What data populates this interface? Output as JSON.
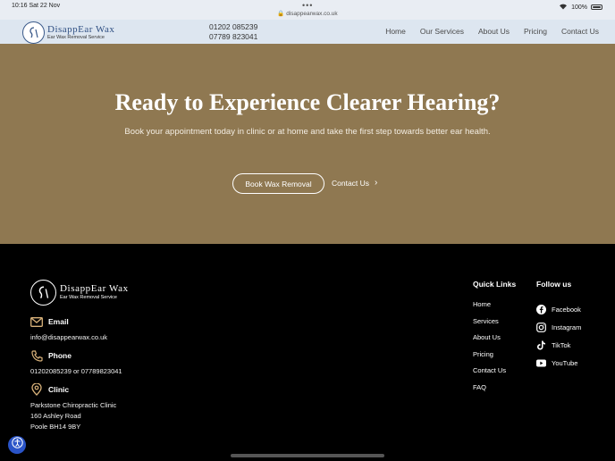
{
  "status": {
    "time": "10:16",
    "date": "Sat 22 Nov",
    "url": "disappearwax.co.uk",
    "battery": "100%"
  },
  "header": {
    "logo_name": "DisappEar Wax",
    "logo_sub": "Ear Wax Removal Service",
    "phone1": "01202 085239",
    "phone2": "07789 823041",
    "nav": [
      "Home",
      "Our Services",
      "About Us",
      "Pricing",
      "Contact Us"
    ]
  },
  "hero": {
    "title": "Ready to Experience Clearer Hearing?",
    "subtitle": "Book your appointment today in clinic or at home and take the first step towards better ear health.",
    "book_label": "Book Wax Removal",
    "contact_label": "Contact Us"
  },
  "footer": {
    "logo_name": "DisappEar Wax",
    "logo_sub": "Ear Wax Removal Service",
    "email_label": "Email",
    "email_value": "info@disappearwax.co.uk",
    "phone_label": "Phone",
    "phone_value": "01202085239 or 07789823041",
    "clinic_label": "Clinic",
    "clinic_lines": [
      "Parkstone Chiropractic Clinic",
      "160 Ashley Road",
      "Poole BH14 9BY"
    ],
    "quick_links_title": "Quick Links",
    "quick_links": [
      "Home",
      "Services",
      "About Us",
      "Pricing",
      "Contact Us",
      "FAQ"
    ],
    "follow_title": "Follow us",
    "follow": [
      "Facebook",
      "Instagram",
      "TikTok",
      "YouTube"
    ]
  },
  "colors": {
    "hero_bg": "#8f7851",
    "header_bg": "#dde6f0",
    "footer_bg": "#000000",
    "accent_icon": "#d9b27a"
  },
  "icons": {
    "email": "envelope-icon",
    "phone": "phone-icon",
    "clinic": "location-pin-icon",
    "facebook": "facebook-icon",
    "instagram": "instagram-icon",
    "tiktok": "tiktok-icon",
    "youtube": "youtube-icon"
  }
}
